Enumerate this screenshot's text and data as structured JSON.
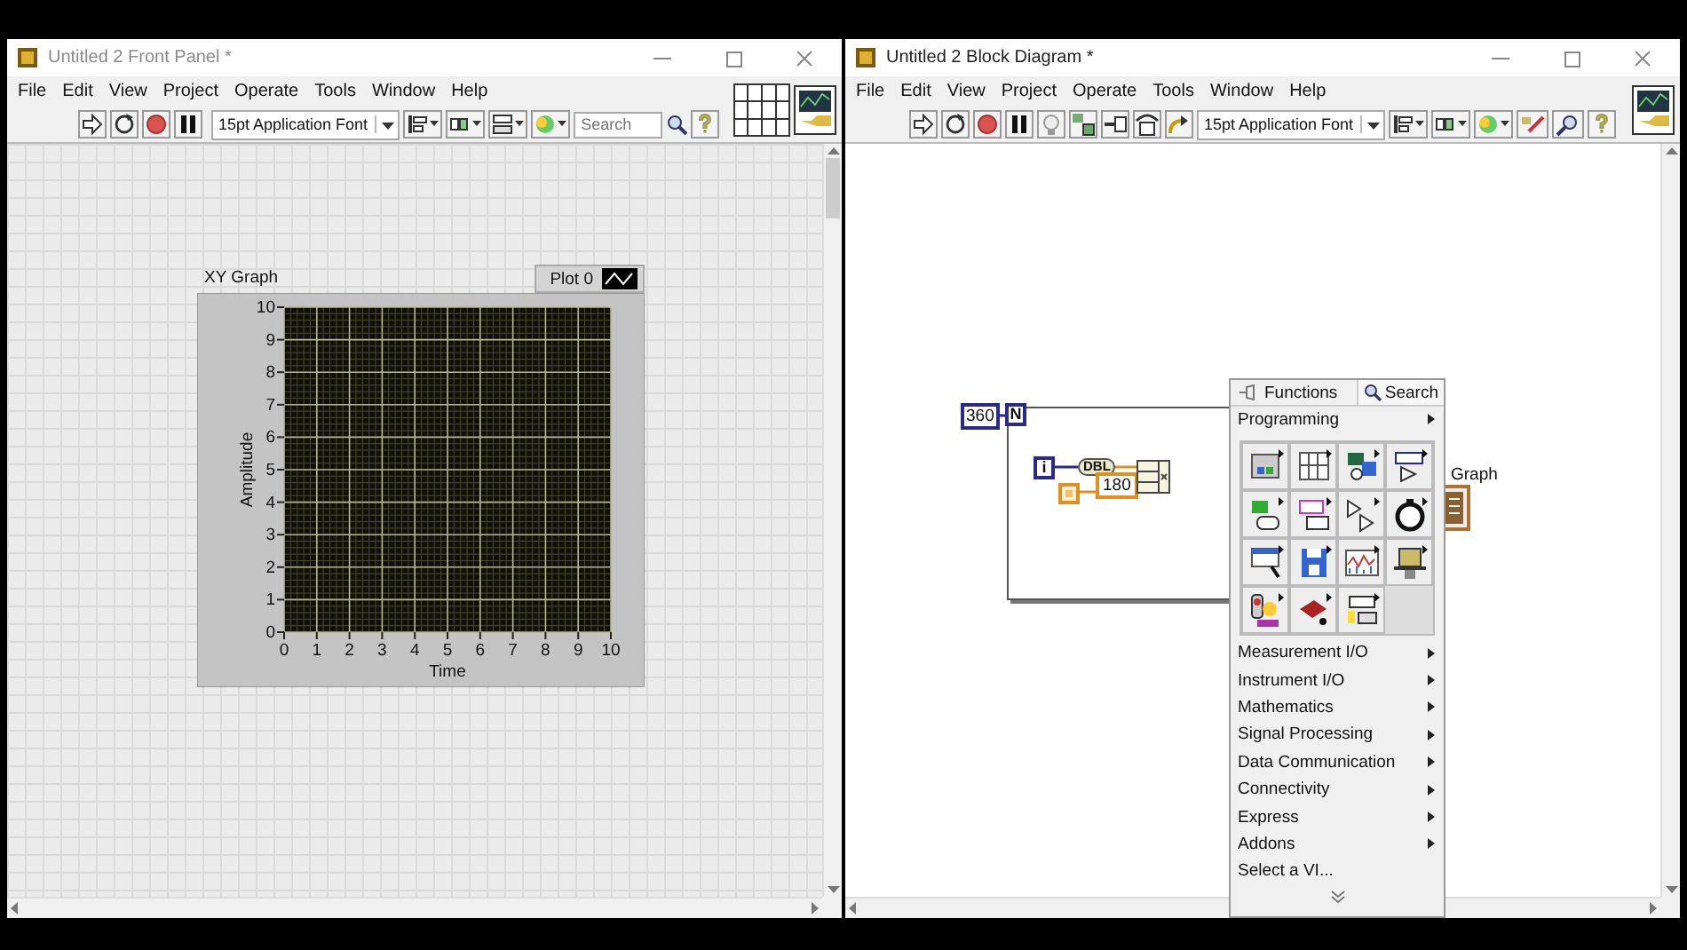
{
  "front_panel": {
    "title": "Untitled 2 Front Panel *",
    "active": false,
    "menu": [
      "File",
      "Edit",
      "View",
      "Project",
      "Operate",
      "Tools",
      "Window",
      "Help"
    ],
    "toolbar": {
      "font": "15pt Application Font",
      "search": {
        "placeholder": "Search"
      }
    },
    "graph": {
      "label": "XY Graph",
      "legend": "Plot 0",
      "chart_data": {
        "type": "line",
        "xlabel": "Time",
        "ylabel": "Amplitude",
        "xlim": [
          0,
          10
        ],
        "ylim": [
          0,
          10
        ],
        "xticks": [
          0,
          1,
          2,
          3,
          4,
          5,
          6,
          7,
          8,
          9,
          10
        ],
        "yticks": [
          0,
          1,
          2,
          3,
          4,
          5,
          6,
          7,
          8,
          9,
          10
        ],
        "grid": true
      }
    }
  },
  "block_diagram": {
    "title": "Untitled 2 Block Diagram *",
    "active": true,
    "menu": [
      "File",
      "Edit",
      "View",
      "Project",
      "Operate",
      "Tools",
      "Window",
      "Help"
    ],
    "toolbar": {
      "font": "15pt Application Font"
    },
    "diagram": {
      "count_constant": "360",
      "count_terminal": "N",
      "iteration_terminal": "i",
      "conversion": "DBL",
      "constant": "180",
      "indicator_label": "Graph"
    },
    "palette": {
      "title": "Functions",
      "search": "Search",
      "category": "Programming",
      "items": [
        {
          "label": "Measurement I/O",
          "submenu": true
        },
        {
          "label": "Instrument I/O",
          "submenu": true
        },
        {
          "label": "Mathematics",
          "submenu": true
        },
        {
          "label": "Signal Processing",
          "submenu": true
        },
        {
          "label": "Data Communication",
          "submenu": true
        },
        {
          "label": "Connectivity",
          "submenu": true
        },
        {
          "label": "Express",
          "submenu": true
        },
        {
          "label": "Addons",
          "submenu": true
        },
        {
          "label": "Select a VI...",
          "submenu": false
        }
      ]
    }
  }
}
